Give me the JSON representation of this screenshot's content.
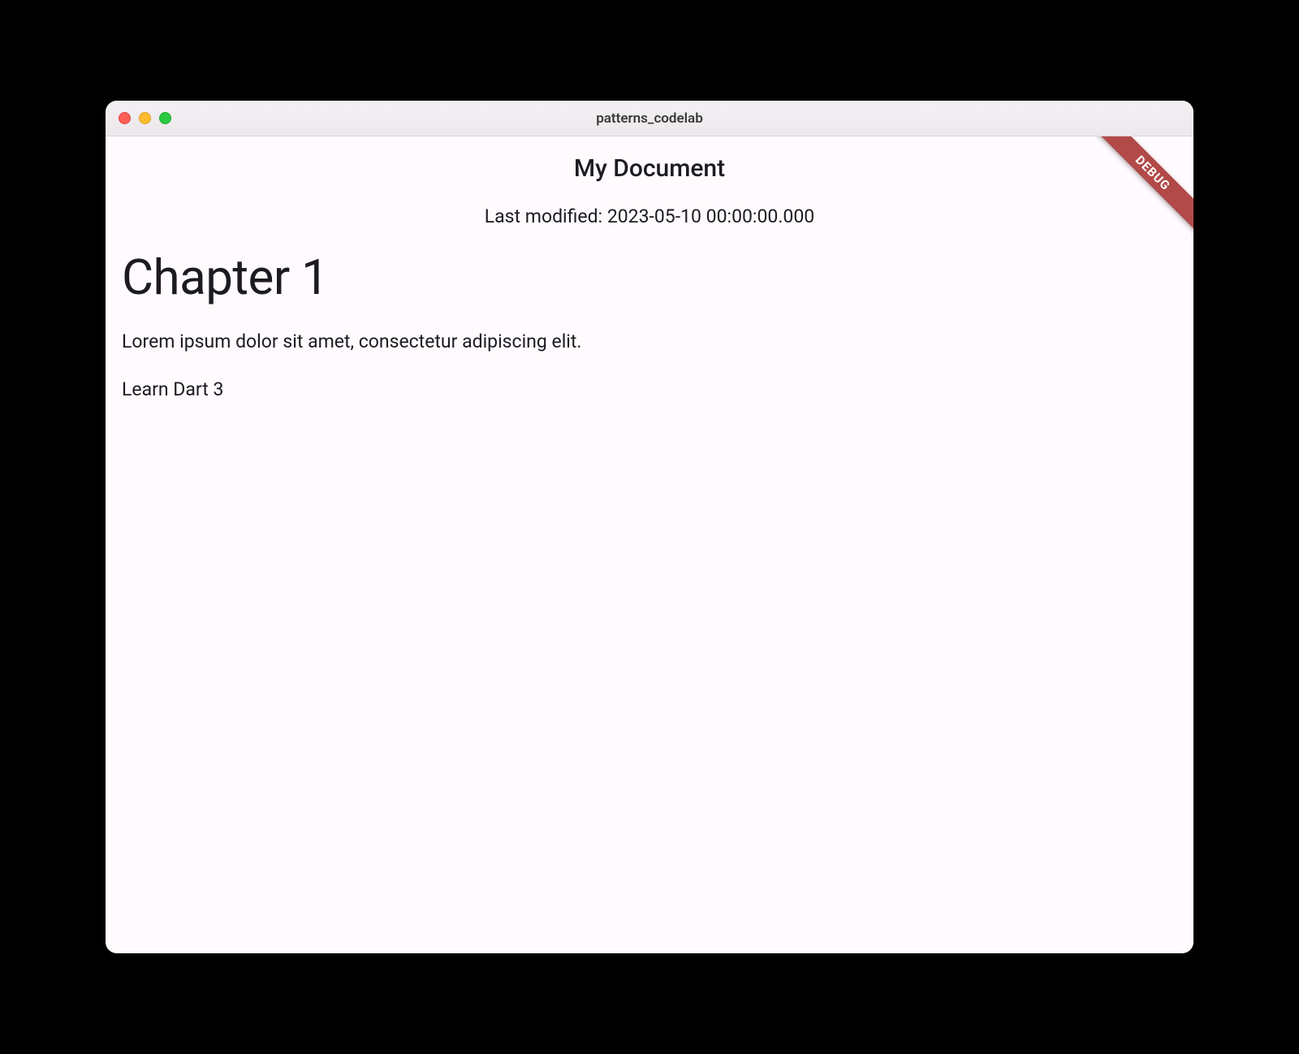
{
  "window": {
    "title": "patterns_codelab"
  },
  "app": {
    "title": "My Document",
    "last_modified": "Last modified: 2023-05-10 00:00:00.000",
    "debug_banner": "DEBUG"
  },
  "content": {
    "heading": "Chapter 1",
    "paragraph": "Lorem ipsum dolor sit amet, consectetur adipiscing elit.",
    "item": "Learn Dart 3"
  }
}
